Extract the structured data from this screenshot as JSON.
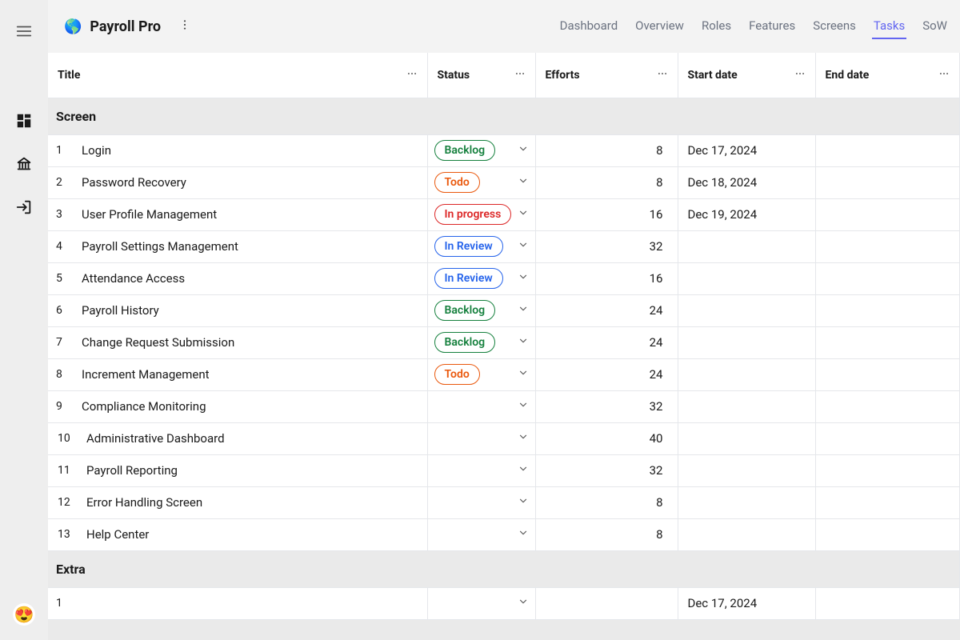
{
  "app": {
    "title": "Payroll Pro",
    "logo_emoji": "🌎"
  },
  "nav_tabs": {
    "items": [
      "Dashboard",
      "Overview",
      "Roles",
      "Features",
      "Screens",
      "Tasks",
      "SoW"
    ],
    "active": "Tasks"
  },
  "emoji_button": "😍",
  "table": {
    "columns": [
      {
        "key": "title",
        "label": "Title"
      },
      {
        "key": "status",
        "label": "Status"
      },
      {
        "key": "efforts",
        "label": "Efforts"
      },
      {
        "key": "start",
        "label": "Start date"
      },
      {
        "key": "end",
        "label": "End date"
      }
    ],
    "sections": [
      {
        "name": "Screen",
        "rows": [
          {
            "idx": "1",
            "title": "Login",
            "status": "Backlog",
            "status_kind": "backlog",
            "efforts": "8",
            "start": "Dec 17, 2024",
            "end": ""
          },
          {
            "idx": "2",
            "title": "Password Recovery",
            "status": "Todo",
            "status_kind": "todo",
            "efforts": "8",
            "start": "Dec 18, 2024",
            "end": ""
          },
          {
            "idx": "3",
            "title": "User Profile Management",
            "status": "In progress",
            "status_kind": "progress",
            "efforts": "16",
            "start": "Dec 19, 2024",
            "end": ""
          },
          {
            "idx": "4",
            "title": "Payroll Settings Management",
            "status": "In Review",
            "status_kind": "review",
            "efforts": "32",
            "start": "",
            "end": ""
          },
          {
            "idx": "5",
            "title": "Attendance Access",
            "status": "In Review",
            "status_kind": "review",
            "efforts": "16",
            "start": "",
            "end": ""
          },
          {
            "idx": "6",
            "title": "Payroll History",
            "status": "Backlog",
            "status_kind": "backlog",
            "efforts": "24",
            "start": "",
            "end": ""
          },
          {
            "idx": "7",
            "title": "Change Request Submission",
            "status": "Backlog",
            "status_kind": "backlog",
            "efforts": "24",
            "start": "",
            "end": ""
          },
          {
            "idx": "8",
            "title": "Increment Management",
            "status": "Todo",
            "status_kind": "todo",
            "efforts": "24",
            "start": "",
            "end": ""
          },
          {
            "idx": "9",
            "title": "Compliance Monitoring",
            "status": "",
            "status_kind": "",
            "efforts": "32",
            "start": "",
            "end": ""
          },
          {
            "idx": "10",
            "title": "Administrative Dashboard",
            "status": "",
            "status_kind": "",
            "efforts": "40",
            "start": "",
            "end": ""
          },
          {
            "idx": "11",
            "title": "Payroll Reporting",
            "status": "",
            "status_kind": "",
            "efforts": "32",
            "start": "",
            "end": ""
          },
          {
            "idx": "12",
            "title": "Error Handling Screen",
            "status": "",
            "status_kind": "",
            "efforts": "8",
            "start": "",
            "end": ""
          },
          {
            "idx": "13",
            "title": "Help Center",
            "status": "",
            "status_kind": "",
            "efforts": "8",
            "start": "",
            "end": ""
          }
        ]
      },
      {
        "name": "Extra",
        "rows": [
          {
            "idx": "1",
            "title": "",
            "status": "",
            "status_kind": "",
            "efforts": "",
            "start": "Dec 17, 2024",
            "end": ""
          }
        ]
      }
    ]
  }
}
